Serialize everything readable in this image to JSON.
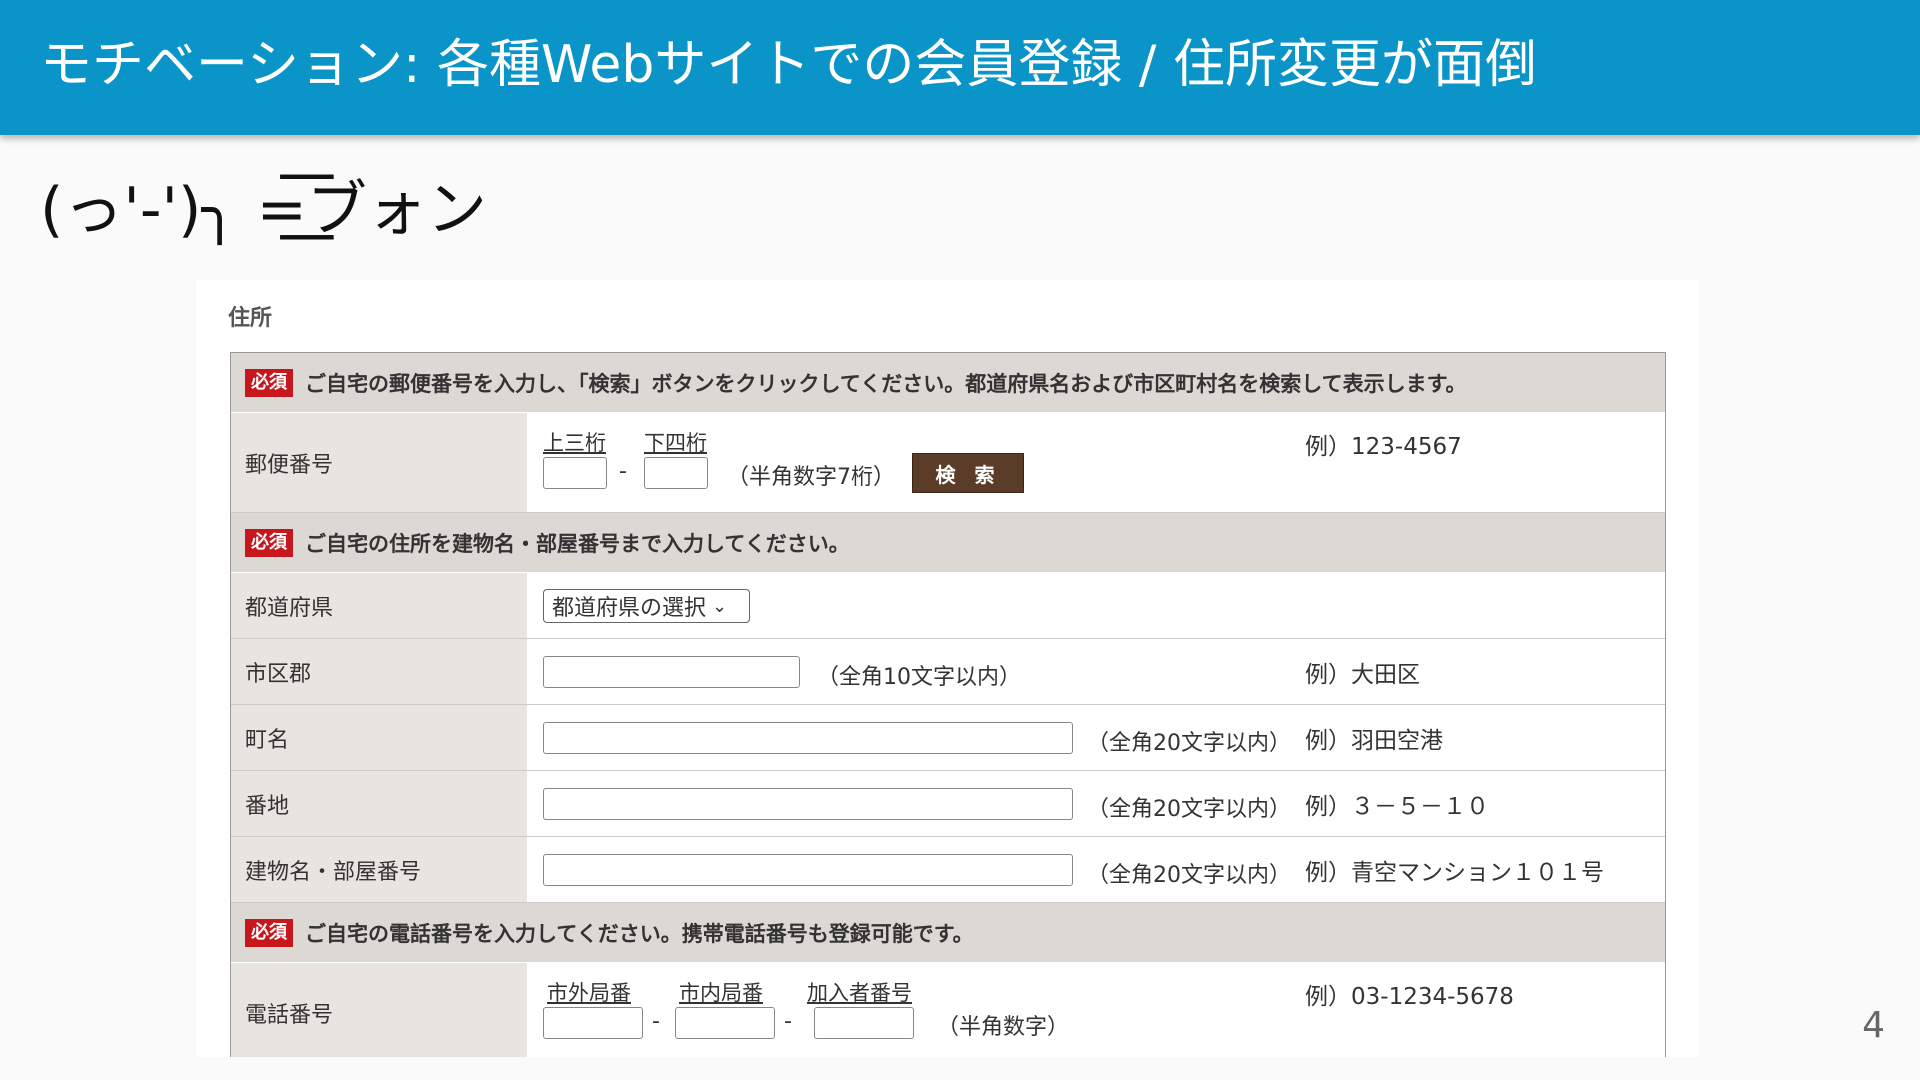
{
  "slide": {
    "title": "モチベーション: 各種Webサイトでの会員登録 / 住所変更が面倒",
    "kaomoji": "(っ'-')╮ =͟͟͞͞ブォン",
    "page_number": "4"
  },
  "form": {
    "section_title": "住所",
    "required_badge": "必須",
    "postal_notice": "ご自宅の郵便番号を入力し、「検索」ボタンをクリックしてください。都道府県名および市区町村名を検索して表示します。",
    "postal": {
      "label": "郵便番号",
      "upper_label": "上三桁",
      "lower_label": "下四桁",
      "separator": "-",
      "note": "（半角数字7桁）",
      "search_button": "検 索",
      "example": "例）123-4567"
    },
    "address_notice": "ご自宅の住所を建物名・部屋番号まで入力してください。",
    "prefecture": {
      "label": "都道府県",
      "select_value": "都道府県の選択"
    },
    "city": {
      "label": "市区郡",
      "note": "（全角10文字以内）",
      "example": "例）大田区"
    },
    "town": {
      "label": "町名",
      "note": "（全角20文字以内）",
      "example": "例）羽田空港"
    },
    "block": {
      "label": "番地",
      "note": "（全角20文字以内）",
      "example": "例）３－５－１０"
    },
    "building": {
      "label": "建物名・部屋番号",
      "note": "（全角20文字以内）",
      "example": "例）青空マンション１０１号"
    },
    "phone_notice": "ご自宅の電話番号を入力してください。携帯電話番号も登録可能です。",
    "phone": {
      "label": "電話番号",
      "area_label": "市外局番",
      "local_label": "市内局番",
      "subscriber_label": "加入者番号",
      "separator": "-",
      "note": "（半角数字）",
      "example": "例）03-1234-5678"
    }
  },
  "colors": {
    "header": "#0b94c7",
    "required_badge": "#c8161d",
    "search_button": "#5b3c29",
    "notice_row": "#dcd8d3",
    "label_cell": "#e8e5e0"
  }
}
